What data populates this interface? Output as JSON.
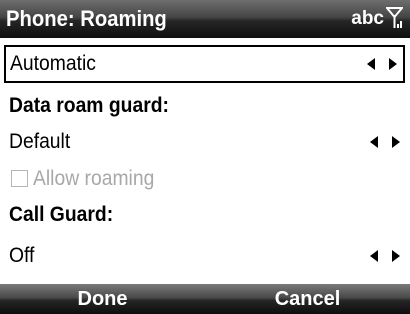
{
  "title_bar": {
    "title": "Phone: Roaming",
    "input_mode": "abc",
    "signal_icon": "antenna-signal-icon"
  },
  "roaming_mode": {
    "value": "Automatic"
  },
  "data_roam_guard": {
    "heading": "Data roam guard:",
    "value": "Default",
    "allow_roaming": {
      "label": "Allow roaming",
      "checked": false,
      "enabled": false
    }
  },
  "call_guard": {
    "heading": "Call Guard:",
    "value": "Off"
  },
  "softkeys": {
    "left": "Done",
    "right": "Cancel"
  },
  "colors": {
    "bar_dark": "#0f0f0f",
    "disabled_text": "#a8a8a8",
    "text": "#000000"
  }
}
